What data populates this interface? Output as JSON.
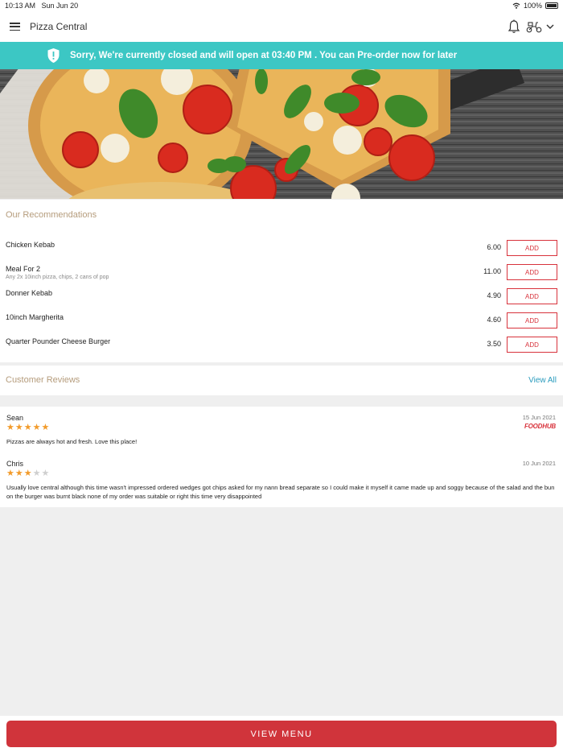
{
  "status_bar": {
    "time": "10:13 AM",
    "date": "Sun Jun 20",
    "battery": "100%"
  },
  "header": {
    "title": "Pizza Central"
  },
  "banner": {
    "message": "Sorry, We're currently closed and will open at 03:40 PM . You can Pre-order now for later",
    "color": "#3cc7c4"
  },
  "recommendations": {
    "title": "Our Recommendations",
    "add_label": "ADD",
    "items": [
      {
        "name": "Chicken Kebab",
        "description": "",
        "price": "6.00"
      },
      {
        "name": "Meal For 2",
        "description": "Any 2x 10inch pizza, chips, 2 cans of pop",
        "price": "11.00"
      },
      {
        "name": "Donner Kebab",
        "description": "",
        "price": "4.90"
      },
      {
        "name": "10inch Margherita",
        "description": "",
        "price": "4.60"
      },
      {
        "name": "Quarter Pounder Cheese Burger",
        "description": "",
        "price": "3.50"
      }
    ]
  },
  "reviews": {
    "title": "Customer Reviews",
    "view_all": "View All",
    "items": [
      {
        "name": "Sean",
        "date": "15 Jun 2021",
        "rating": 5,
        "source": "FOODHUB",
        "text": "Pizzas are always hot and fresh. Love this place!"
      },
      {
        "name": "Chris",
        "date": "10 Jun 2021",
        "rating": 3,
        "source": "",
        "text": "Usually love central although this time wasn't impressed ordered wedges got chips asked for my nann bread separate so I could make it myself it came made up and soggy because of the salad and the bun on the burger was burnt black none of my order was suitable or right this time very disappointed"
      }
    ]
  },
  "footer": {
    "view_menu": "VIEW MENU",
    "color": "#d0343b"
  },
  "icons": [
    "menu-icon",
    "bell-icon",
    "scooter-icon",
    "chevron-down-icon",
    "shield-alert-icon",
    "wifi-icon",
    "battery-icon",
    "star-icon"
  ]
}
